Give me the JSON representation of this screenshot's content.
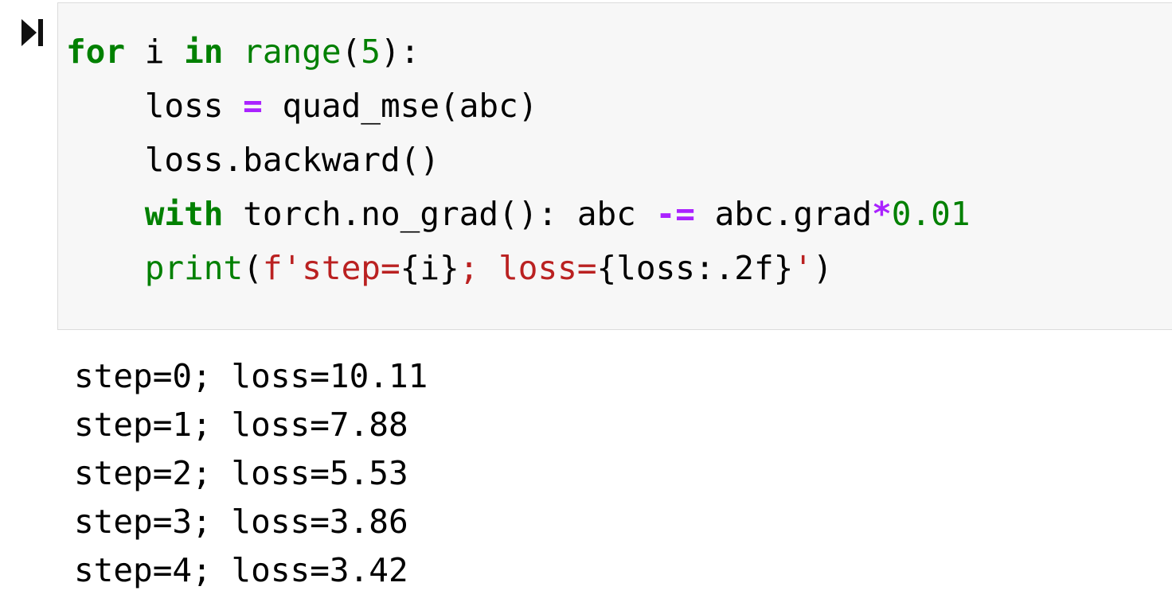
{
  "cell": {
    "run_icon": "run-cell-icon",
    "code_lines": [
      {
        "indent": "",
        "tokens": [
          {
            "t": "for",
            "c": "kw"
          },
          {
            "t": " i ",
            "c": ""
          },
          {
            "t": "in",
            "c": "kw"
          },
          {
            "t": " ",
            "c": ""
          },
          {
            "t": "range",
            "c": "bi"
          },
          {
            "t": "(",
            "c": ""
          },
          {
            "t": "5",
            "c": "num"
          },
          {
            "t": "):",
            "c": ""
          }
        ]
      },
      {
        "indent": "    ",
        "tokens": [
          {
            "t": "loss ",
            "c": ""
          },
          {
            "t": "=",
            "c": "op"
          },
          {
            "t": " quad_mse(abc)",
            "c": ""
          }
        ]
      },
      {
        "indent": "    ",
        "tokens": [
          {
            "t": "loss.backward()",
            "c": ""
          }
        ]
      },
      {
        "indent": "    ",
        "tokens": [
          {
            "t": "with",
            "c": "kw"
          },
          {
            "t": " torch.no_grad(): abc ",
            "c": ""
          },
          {
            "t": "-=",
            "c": "op"
          },
          {
            "t": " abc.grad",
            "c": ""
          },
          {
            "t": "*",
            "c": "op"
          },
          {
            "t": "0.01",
            "c": "num"
          }
        ]
      },
      {
        "indent": "    ",
        "tokens": [
          {
            "t": "print",
            "c": "bi"
          },
          {
            "t": "(",
            "c": ""
          },
          {
            "t": "f'step=",
            "c": "str"
          },
          {
            "t": "{i}",
            "c": "interp"
          },
          {
            "t": "; loss=",
            "c": "str"
          },
          {
            "t": "{loss:.2f}",
            "c": "interp"
          },
          {
            "t": "'",
            "c": "str"
          },
          {
            "t": ")",
            "c": ""
          }
        ]
      }
    ]
  },
  "output": {
    "lines": [
      "step=0; loss=10.11",
      "step=1; loss=7.88",
      "step=2; loss=5.53",
      "step=3; loss=3.86",
      "step=4; loss=3.42"
    ]
  },
  "colors": {
    "keyword": "#008000",
    "operator": "#aa22ff",
    "string": "#ba2121",
    "cell_background": "#f7f7f7"
  }
}
